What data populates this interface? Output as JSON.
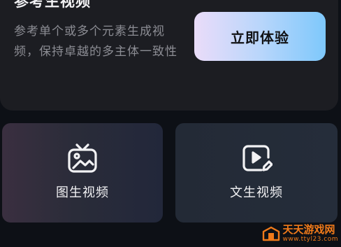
{
  "reference_card": {
    "title": "参考生视频",
    "description": "参考单个或多个元素生成视频，保持卓越的多主体一致性",
    "button_label": "立即体验"
  },
  "features": [
    {
      "label": "图生视频",
      "icon": "tv-image-icon"
    },
    {
      "label": "文生视频",
      "icon": "video-edit-icon"
    }
  ],
  "watermark": {
    "name": "天天游戏网",
    "url": "www.ttyl23.com"
  },
  "colors": {
    "background": "#0d1016",
    "card": "#1c1d22",
    "button_gradient_start": "#eadcf9",
    "button_gradient_end": "#7ec8fb",
    "watermark": "#f07a1a"
  }
}
